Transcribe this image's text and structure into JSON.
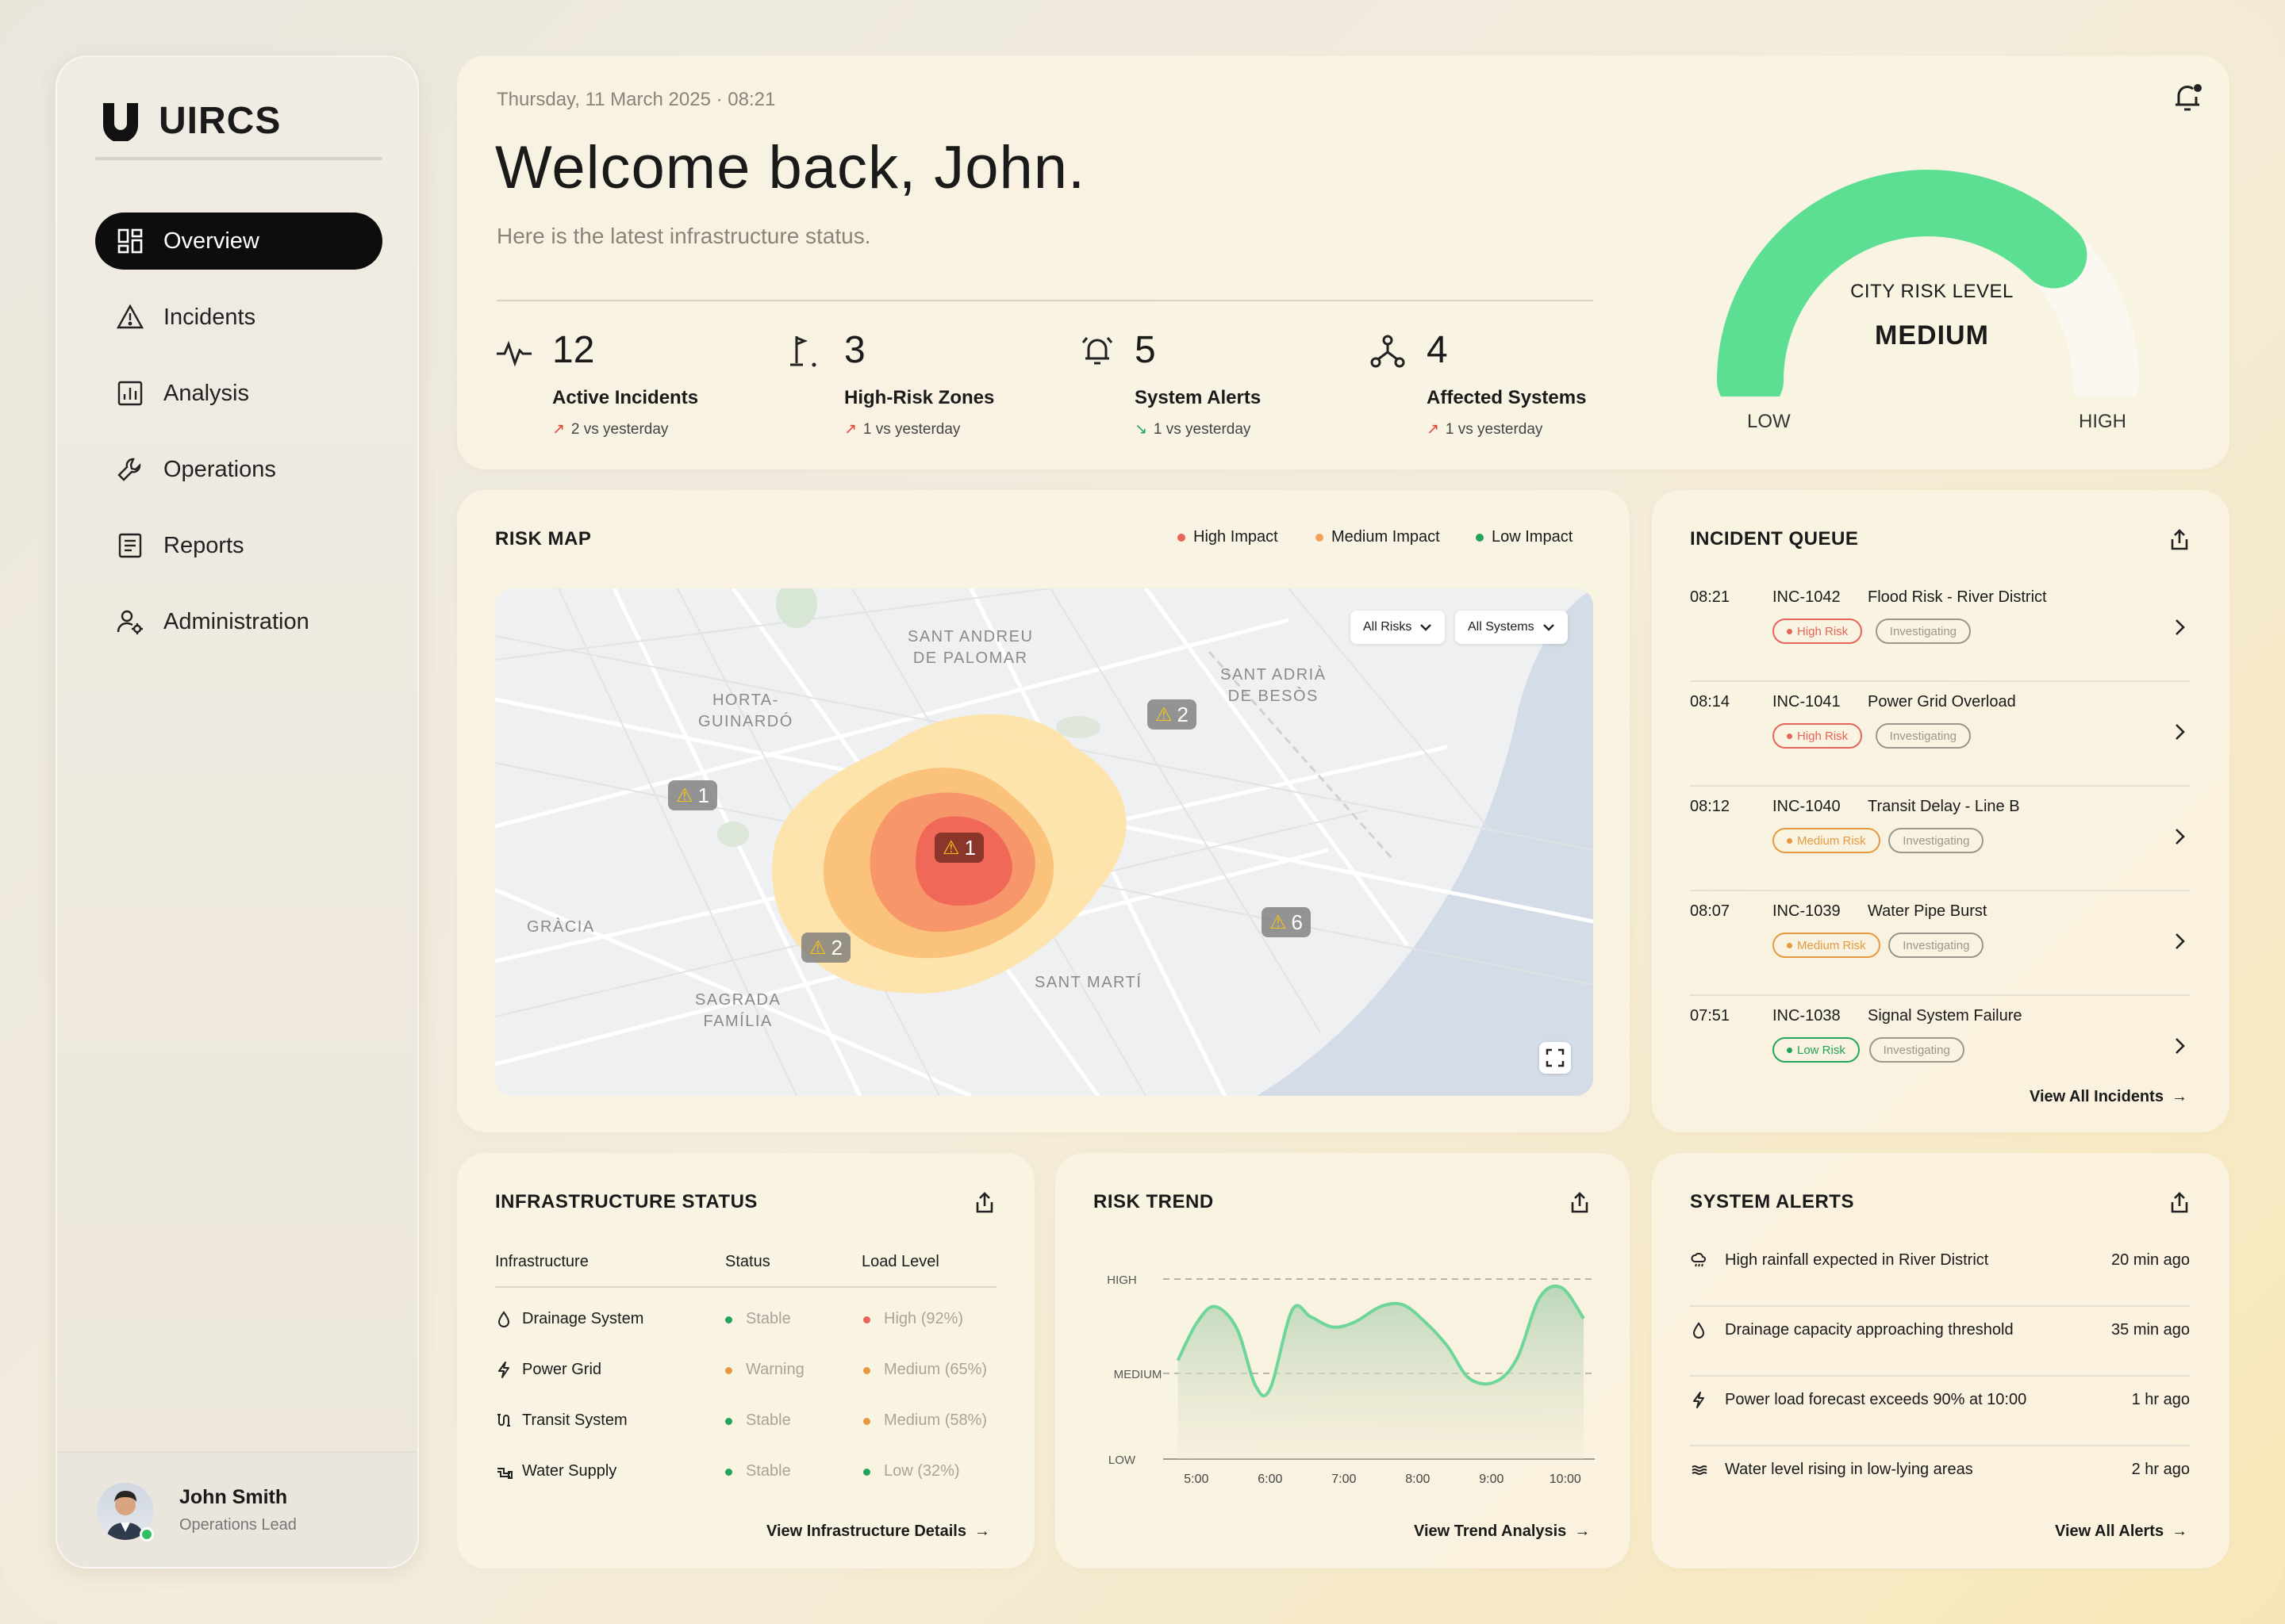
{
  "app": {
    "name": "UIRCS"
  },
  "sidebar": {
    "items": [
      {
        "label": "Overview",
        "icon": "dashboard-icon"
      },
      {
        "label": "Incidents",
        "icon": "warning-triangle-icon"
      },
      {
        "label": "Analysis",
        "icon": "chart-icon"
      },
      {
        "label": "Operations",
        "icon": "wrench-icon"
      },
      {
        "label": "Reports",
        "icon": "document-icon"
      },
      {
        "label": "Administration",
        "icon": "user-gear-icon"
      }
    ],
    "user": {
      "name": "John Smith",
      "role": "Operations Lead"
    }
  },
  "header": {
    "datetime": "Thursday, 11 March 2025 · 08:21",
    "welcome": "Welcome back, John.",
    "subtitle": "Here is the latest infrastructure status.",
    "stats": [
      {
        "value": "12",
        "label": "Active Incidents",
        "delta": "2 vs yesterday",
        "trend": "up"
      },
      {
        "value": "3",
        "label": "High-Risk Zones",
        "delta": "1 vs yesterday",
        "trend": "up"
      },
      {
        "value": "5",
        "label": "System Alerts",
        "delta": "1 vs yesterday",
        "trend": "down"
      },
      {
        "value": "4",
        "label": "Affected Systems",
        "delta": "1 vs yesterday",
        "trend": "up"
      }
    ],
    "gauge": {
      "caption": "CITY RISK LEVEL",
      "value": "MEDIUM",
      "low": "LOW",
      "high": "HIGH",
      "level_fraction": 0.75,
      "color": "#5ddf93"
    }
  },
  "risk_map": {
    "title": "RISK MAP",
    "legend": [
      {
        "label": "High Impact",
        "color": "#e8645a"
      },
      {
        "label": "Medium Impact",
        "color": "#f0a15a"
      },
      {
        "label": "Low Impact",
        "color": "#24a35a"
      }
    ],
    "filters": [
      "All Risks",
      "All Systems"
    ],
    "places": [
      "SANT ANDREU\nDE PALOMAR",
      "SANT ADRIÀ\nDE BESÒS",
      "HORTA-\nGUINARDÓ",
      "GRÀCIA",
      "SANT MARTÍ",
      "SAGRADA\nFAMÍLIA"
    ],
    "markers": [
      "1",
      "2",
      "1",
      "2",
      "6"
    ]
  },
  "incident_queue": {
    "title": "INCIDENT QUEUE",
    "rows": [
      {
        "time": "08:21",
        "id": "INC-1042",
        "desc": "Flood Risk - River District",
        "risk": "High Risk",
        "status": "Investigating"
      },
      {
        "time": "08:14",
        "id": "INC-1041",
        "desc": "Power Grid Overload",
        "risk": "High Risk",
        "status": "Investigating"
      },
      {
        "time": "08:12",
        "id": "INC-1040",
        "desc": "Transit Delay - Line B",
        "risk": "Medium Risk",
        "status": "Investigating"
      },
      {
        "time": "08:07",
        "id": "INC-1039",
        "desc": "Water Pipe Burst",
        "risk": "Medium Risk",
        "status": "Investigating"
      },
      {
        "time": "07:51",
        "id": "INC-1038",
        "desc": "Signal System Failure",
        "risk": "Low Risk",
        "status": "Investigating"
      }
    ],
    "link": "View All Incidents"
  },
  "infrastructure": {
    "title": "INFRASTRUCTURE STATUS",
    "headers": [
      "Infrastructure",
      "Status",
      "Load Level"
    ],
    "rows": [
      {
        "name": "Drainage System",
        "status": "Stable",
        "load": "High (92%)",
        "icon": "drop-icon"
      },
      {
        "name": "Power Grid",
        "status": "Warning",
        "load": "Medium (65%)",
        "icon": "bolt-icon"
      },
      {
        "name": "Transit System",
        "status": "Stable",
        "load": "Medium (58%)",
        "icon": "route-icon"
      },
      {
        "name": "Water Supply",
        "status": "Stable",
        "load": "Low (32%)",
        "icon": "pipe-icon"
      }
    ],
    "link": "View Infrastructure Details"
  },
  "risk_trend": {
    "title": "RISK TREND",
    "link": "View Trend Analysis"
  },
  "chart_data": {
    "type": "area",
    "title": "RISK TREND",
    "x": [
      "5:00",
      "6:00",
      "7:00",
      "8:00",
      "9:00",
      "10:00"
    ],
    "y_ticks": [
      "HIGH",
      "MEDIUM",
      "LOW"
    ],
    "series": [
      {
        "values": [
          [
            4.75,
            1.55
          ],
          [
            5.0,
            1.98
          ],
          [
            5.25,
            2.18
          ],
          [
            5.55,
            1.92
          ],
          [
            5.8,
            1.26
          ],
          [
            6.0,
            1.22
          ],
          [
            6.3,
            2.14
          ],
          [
            6.55,
            2.06
          ],
          [
            6.85,
            1.94
          ],
          [
            7.15,
            2.0
          ],
          [
            7.5,
            2.18
          ],
          [
            7.8,
            2.2
          ],
          [
            8.1,
            2.0
          ],
          [
            8.4,
            1.72
          ],
          [
            8.7,
            1.34
          ],
          [
            9.05,
            1.3
          ],
          [
            9.35,
            1.58
          ],
          [
            9.65,
            2.28
          ],
          [
            9.95,
            2.4
          ],
          [
            10.25,
            2.04
          ]
        ]
      }
    ],
    "xlim": [
      4.55,
      10.4
    ],
    "ylim": [
      0.4,
      2.75
    ],
    "grid": "dashed at HIGH and MEDIUM",
    "color": "#6fd69a"
  },
  "system_alerts": {
    "title": "SYSTEM ALERTS",
    "rows": [
      {
        "text": "High rainfall expected in River District",
        "time": "20 min ago",
        "icon": "rain-cloud-icon"
      },
      {
        "text": "Drainage capacity approaching threshold",
        "time": "35 min ago",
        "icon": "drop-icon"
      },
      {
        "text": "Power load forecast exceeds 90% at 10:00",
        "time": "1 hr ago",
        "icon": "bolt-icon"
      },
      {
        "text": "Water level rising in low-lying areas",
        "time": "2 hr ago",
        "icon": "waves-icon"
      }
    ],
    "link": "View All Alerts"
  },
  "colors": {
    "high": "#e8645a",
    "medium": "#e59a3f",
    "low": "#24a35a",
    "muted": "#a9a49a"
  }
}
